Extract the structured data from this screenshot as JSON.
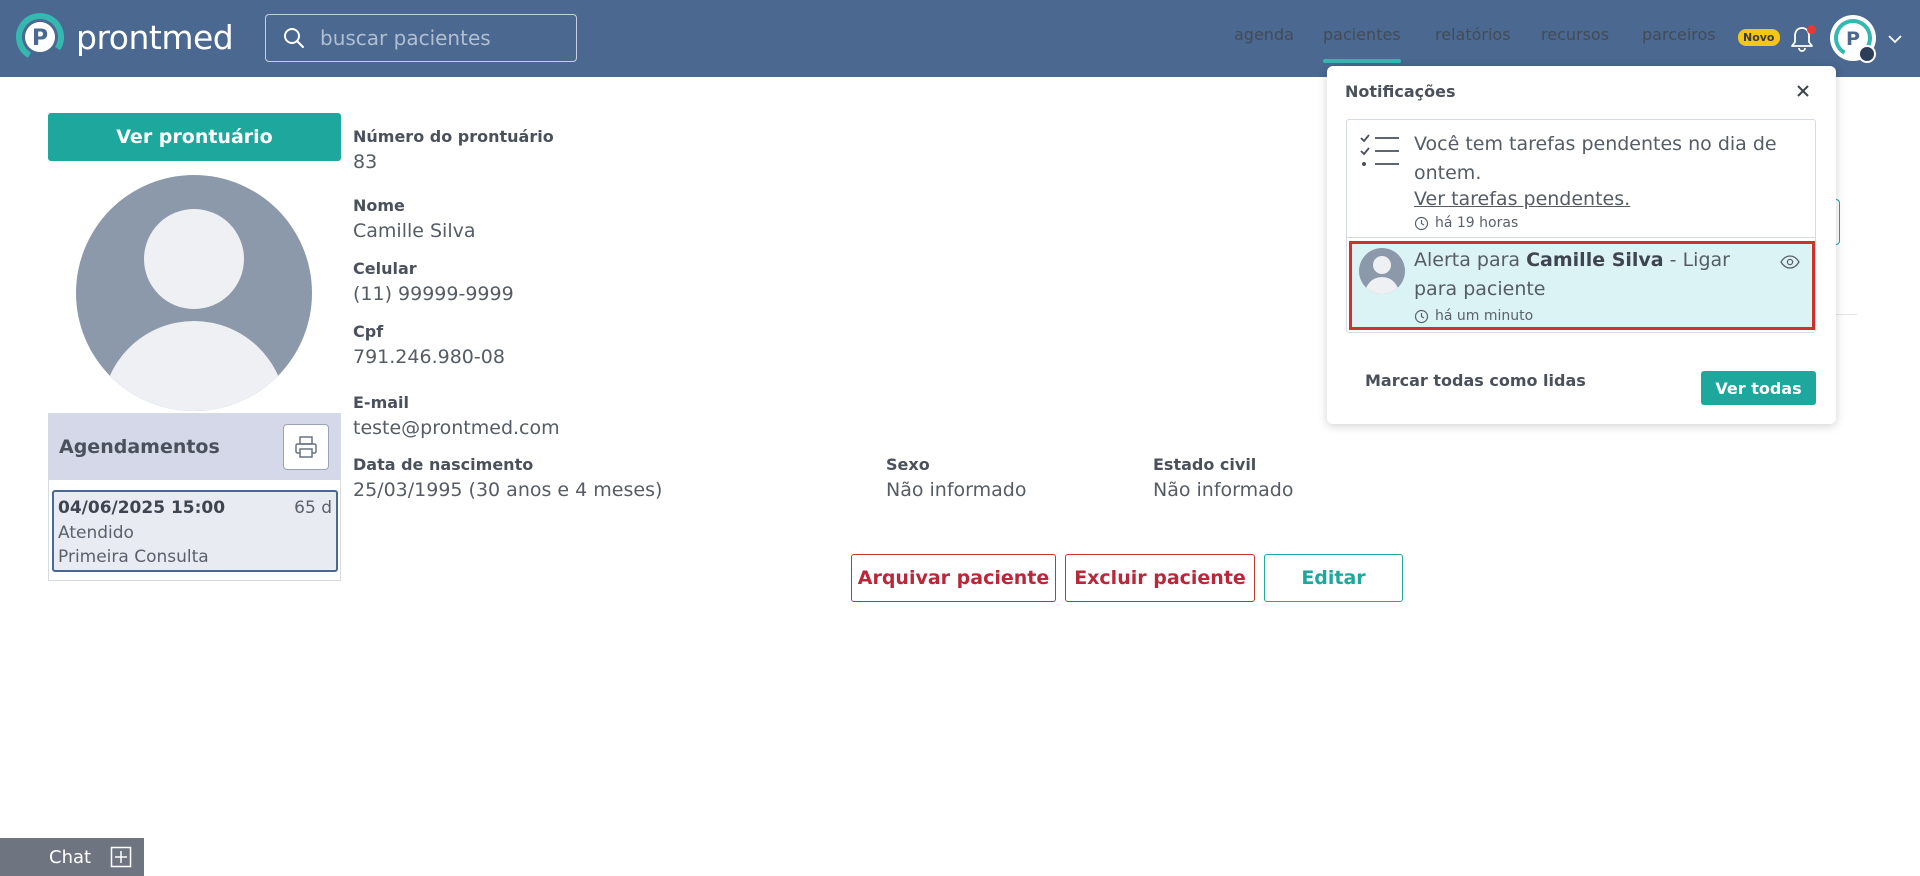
{
  "header": {
    "logo_text": "prontmed",
    "search_placeholder": "buscar pacientes",
    "nav": {
      "agenda": "agenda",
      "pacientes": "pacientes",
      "relatorios": "relatórios",
      "recursos": "recursos",
      "parceiros": "parceiros",
      "novo_badge": "Novo"
    },
    "accent_color": "#35b8b0",
    "bg_color": "#4a6890"
  },
  "sidebar": {
    "ver_prontuario": "Ver prontuário",
    "agendamentos_title": "Agendamentos",
    "appointments": [
      {
        "datetime": "04/06/2025 15:00",
        "days": "65 d",
        "status": "Atendido",
        "type": "Primeira Consulta"
      }
    ]
  },
  "patient": {
    "numero_label": "Número do prontuário",
    "numero": "83",
    "nome_label": "Nome",
    "nome": "Camille Silva",
    "celular_label": "Celular",
    "celular": "(11) 99999-9999",
    "cpf_label": "Cpf",
    "cpf": "791.246.980-08",
    "email_label": "E-mail",
    "email": "teste@prontmed.com",
    "nascimento_label": "Data de nascimento",
    "nascimento": "25/03/1995 (30 anos e 4 meses)",
    "sexo_label": "Sexo",
    "sexo": "Não informado",
    "estado_civil_label": "Estado civil",
    "estado_civil": "Não informado"
  },
  "actions": {
    "arquivar": "Arquivar paciente",
    "excluir": "Excluir paciente",
    "editar": "Editar"
  },
  "notifications": {
    "title": "Notificações",
    "items": [
      {
        "text": "Você tem tarefas pendentes no dia de ontem.",
        "link": "Ver tarefas pendentes.",
        "time": "há 19 horas"
      },
      {
        "prefix": "Alerta para ",
        "name": "Camille Silva",
        "suffix": " - Ligar para paciente",
        "time": "há um minuto"
      }
    ],
    "mark_all": "Marcar todas como lidas",
    "see_all": "Ver todas"
  },
  "chat": {
    "label": "Chat"
  }
}
